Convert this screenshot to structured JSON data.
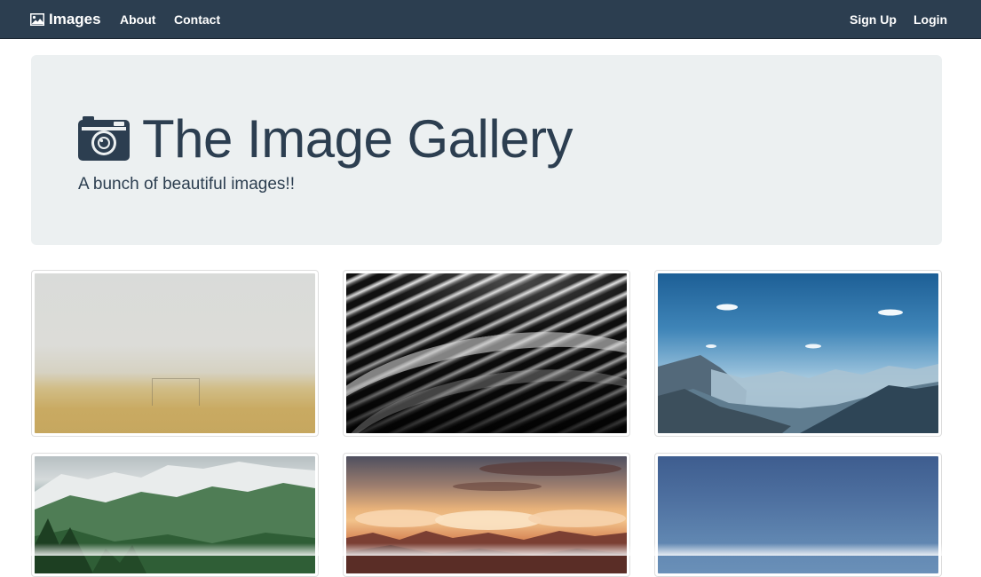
{
  "navbar": {
    "brand_label": "Images",
    "links": [
      {
        "label": "About"
      },
      {
        "label": "Contact"
      }
    ],
    "right_links": [
      {
        "label": "Sign Up"
      },
      {
        "label": "Login"
      }
    ]
  },
  "jumbotron": {
    "title": "The Image Gallery",
    "subtitle": "A bunch of beautiful images!!",
    "icon": "camera-icon"
  },
  "gallery": {
    "items": [
      {
        "name": "foggy-field-goal"
      },
      {
        "name": "architecture-waves-bw"
      },
      {
        "name": "mountain-valley-sky"
      },
      {
        "name": "green-snowy-mountains"
      },
      {
        "name": "sunset-clouds-mountains"
      },
      {
        "name": "blue-gradient-sky"
      }
    ]
  },
  "colors": {
    "navbar": "#2c3e50",
    "jumbotron": "#ecf0f1",
    "heading": "#2c3e50"
  }
}
